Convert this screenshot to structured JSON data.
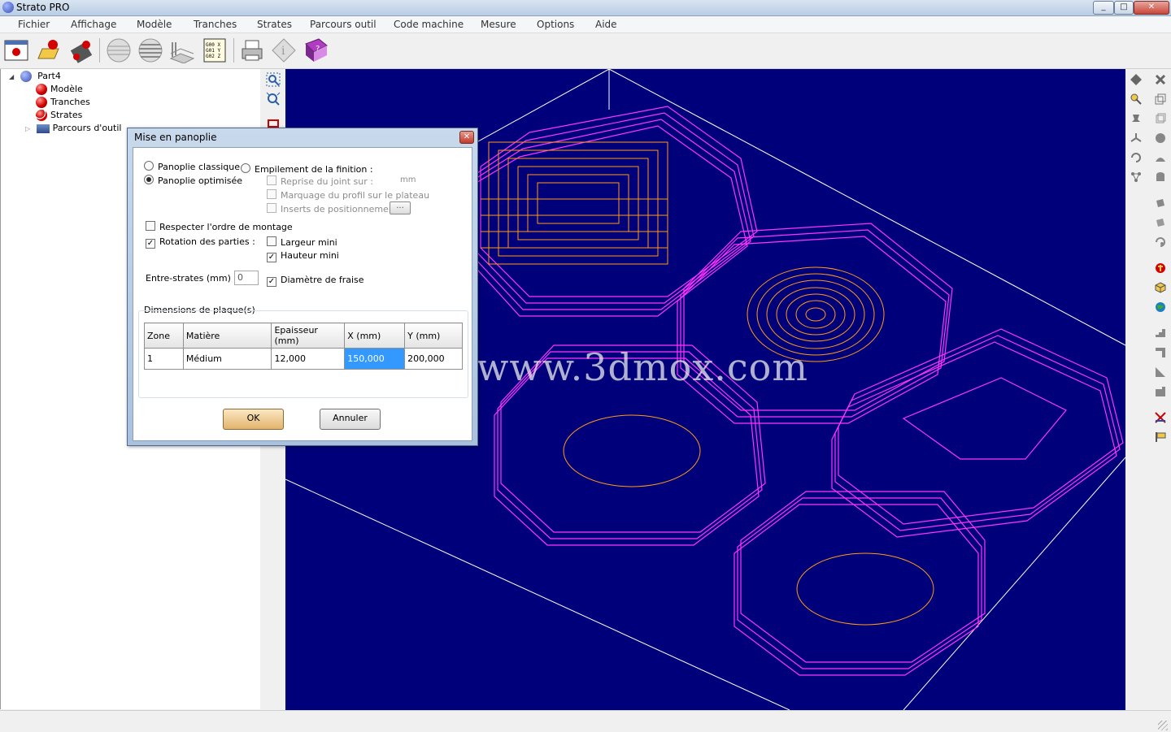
{
  "window": {
    "title": "Strato PRO",
    "minimize": "_",
    "maximize": "□",
    "close": "✕"
  },
  "menu": [
    "Fichier",
    "Affichage",
    "Modèle",
    "Tranches",
    "Strates",
    "Parcours outil",
    "Code machine",
    "Mesure",
    "Options",
    "Aide"
  ],
  "toolbar": {
    "gcode_text": "G00 X\nG01 Y\nG02 Z"
  },
  "tree": {
    "root": "Part4",
    "items": [
      "Modèle",
      "Tranches",
      "Strates",
      "Parcours d'outil"
    ]
  },
  "dialog": {
    "title": "Mise en panoplie",
    "close": "✕",
    "radio_classique": "Panoplie classique",
    "radio_optimisee": "Panoplie optimisée",
    "radio_empilement": "Empilement de la finition :",
    "reprise_joint": "Reprise du joint sur :",
    "reprise_unit": "mm",
    "marquage_profil": "Marquage du profil sur le plateau",
    "inserts": "Inserts de positionnement",
    "inserts_btn": "...",
    "respecter_ordre": "Respecter l'ordre de montage",
    "rotation_parties": "Rotation des parties :",
    "largeur_mini": "Largeur mini",
    "hauteur_mini": "Hauteur mini",
    "entre_strates_label": "Entre-strates (mm) :",
    "entre_strates_value": "0",
    "diametre_fraise": "Diamètre de fraise",
    "dimensions_label": "Dimensions de plaque(s)",
    "table": {
      "headers": [
        "Zone",
        "Matière",
        "Epaisseur (mm)",
        "X (mm)",
        "Y (mm)"
      ],
      "rows": [
        [
          "1",
          "Médium",
          "12,000",
          "150,000",
          "200,000"
        ]
      ]
    },
    "ok": "OK",
    "annuler": "Annuler"
  },
  "watermark": "模型网www.3dmox.com",
  "colors": {
    "viewport_bg": "#00007b",
    "toolpath_magenta": "#ff33ff",
    "toolpath_orange": "#ff9a1a",
    "selection": "#3399ff"
  }
}
